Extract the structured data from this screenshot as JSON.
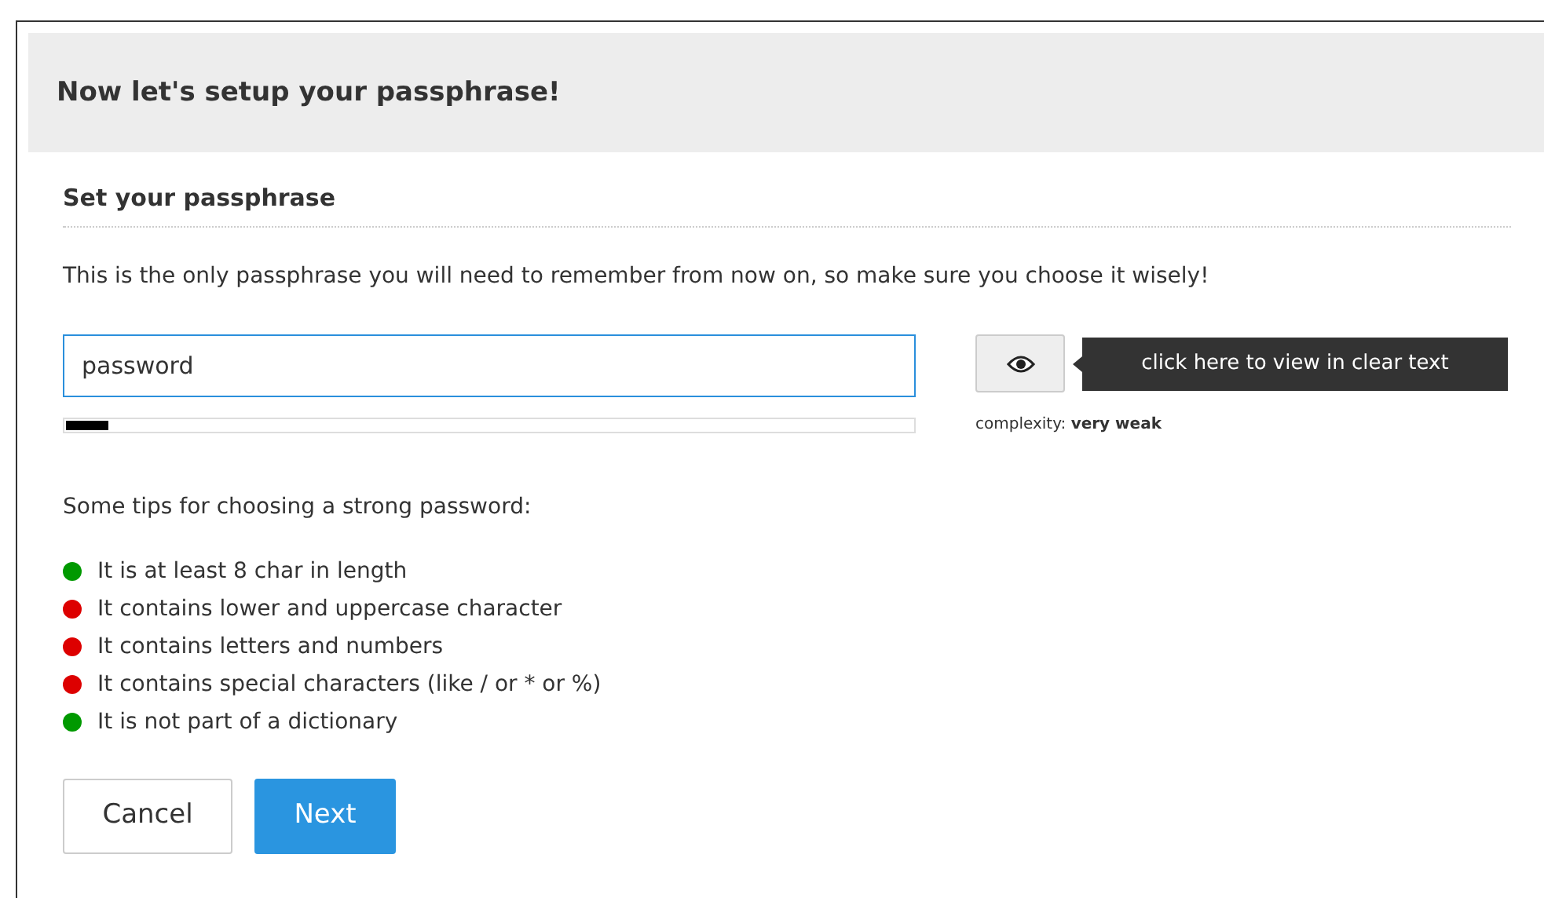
{
  "header": {
    "title": "Now let's setup your passphrase!"
  },
  "section": {
    "title": "Set your passphrase",
    "intro": "This is the only passphrase you will need to remember from now on, so make sure you choose it wisely!"
  },
  "passphrase": {
    "value": "password",
    "strength": {
      "level": 0.05
    }
  },
  "view_button": {
    "tooltip": "click here to view in clear text"
  },
  "complexity": "complexity: **very weak**",
  "tips": {
    "title": "Some tips for choosing a strong password:",
    "items": [
      {
        "text": "It is at least 8 char in length",
        "color": "#009900"
      },
      {
        "text": "It contains lower and uppercase character",
        "color": "#dd0000"
      },
      {
        "text": "It contains letters and numbers",
        "color": "#dd0000"
      },
      {
        "text": "It contains special characters (like / or * or %)",
        "color": "#dd0000"
      },
      {
        "text": "It is not part of a dictionary",
        "color": "#009900"
      }
    ]
  },
  "buttons": [
    {
      "label": "Cancel",
      "kind": "secondary"
    },
    {
      "label": "Next",
      "kind": "primary"
    }
  ]
}
